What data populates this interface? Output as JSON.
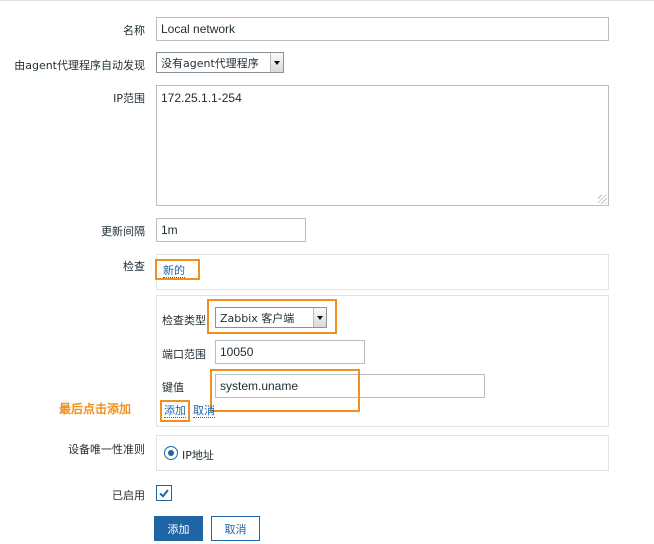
{
  "form": {
    "name_label": "名称",
    "name_value": "Local network",
    "discovery_label": "由agent代理程序自动发现",
    "discovery_value": "没有agent代理程序",
    "ip_range_label": "IP范围",
    "ip_range_value": "172.25.1.1-254",
    "update_interval_label": "更新间隔",
    "update_interval_value": "1m",
    "checks_label": "检查",
    "checks_new_link": "新的",
    "check_type_label": "检查类型",
    "check_type_value": "Zabbix 客户端",
    "port_range_label": "端口范围",
    "port_range_value": "10050",
    "key_label": "键值",
    "key_value": "system.uname",
    "add_link": "添加",
    "cancel_link": "取消",
    "uniqueness_label": "设备唯一性准则",
    "uniqueness_option": "IP地址",
    "enabled_label": "已启用",
    "enabled_checked": true,
    "add_button": "添加",
    "cancel_button": "取消"
  },
  "annotation": {
    "hint_text": "最后点击添加",
    "highlight_color": "#f0901f"
  },
  "colors": {
    "accent": "#1f65a6",
    "border": "#b7bfc4"
  }
}
